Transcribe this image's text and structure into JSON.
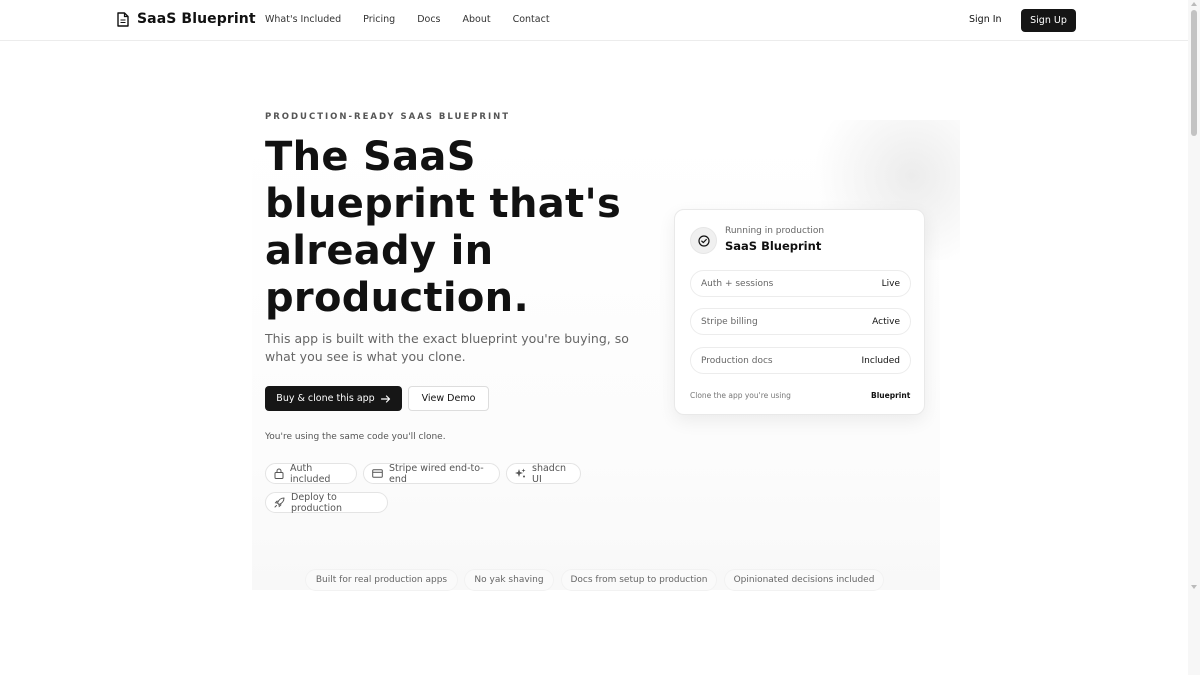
{
  "nav": {
    "brand": "SaaS Blueprint",
    "brand_icon": "document-icon",
    "links": [
      "What's Included",
      "Pricing",
      "Docs",
      "About",
      "Contact"
    ],
    "sign_in": "Sign In",
    "sign_up": "Sign Up"
  },
  "hero": {
    "eyebrow": "PRODUCTION-READY SAAS BLUEPRINT",
    "headline_lines": [
      "The SaaS",
      "blueprint that's",
      "already in",
      "production."
    ],
    "subtext": "This app is built with the exact blueprint you're buying, so what you see is what you clone.",
    "primary_button": "Buy & clone this app",
    "primary_button_icon": "arrow-right-icon",
    "secondary_button": "View Demo",
    "note": "You're using the same code you'll clone.",
    "pills": [
      {
        "label": "Auth included",
        "icon": "lock-icon"
      },
      {
        "label": "Stripe wired end-to-end",
        "icon": "credit-card-icon"
      },
      {
        "label": "shadcn UI",
        "icon": "sparkles-icon"
      },
      {
        "label": "Deploy to production",
        "icon": "rocket-icon"
      }
    ]
  },
  "card": {
    "icon": "check-circle-icon",
    "eyebrow": "Running in production",
    "title": "SaaS Blueprint",
    "rows": [
      {
        "label": "Auth + sessions",
        "value": "Live"
      },
      {
        "label": "Stripe billing",
        "value": "Active"
      },
      {
        "label": "Production docs",
        "value": "Included"
      }
    ],
    "footer_left": "Clone the app you're using",
    "footer_right": "Blueprint"
  },
  "features": [
    "Built for real production apps",
    "No yak shaving",
    "Docs from setup to production",
    "Opinionated decisions included"
  ],
  "colors": {
    "primary": "#161616",
    "muted_text": "#666666",
    "border": "#e4e4e4"
  }
}
